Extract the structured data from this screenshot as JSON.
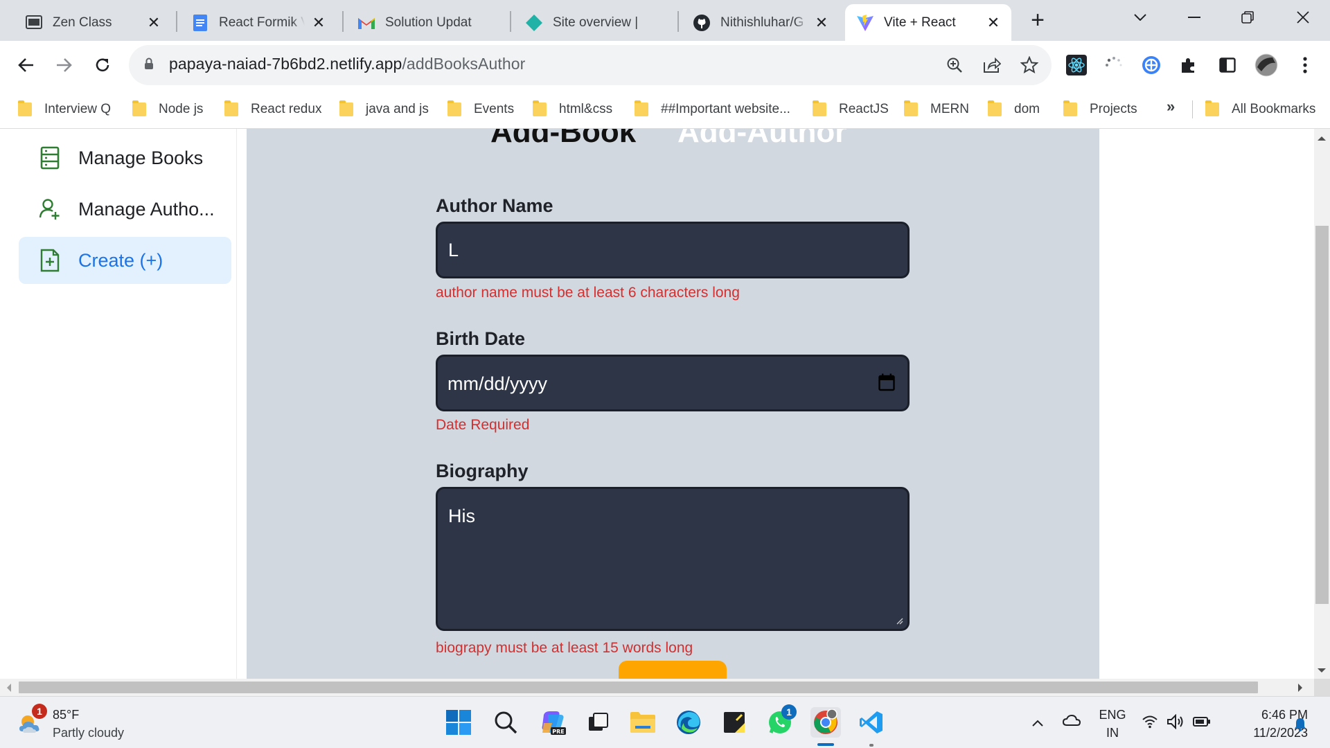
{
  "browser": {
    "tabs": [
      {
        "title": "Zen Class",
        "favicon": "zen-class-favicon"
      },
      {
        "title": "React Formik V",
        "favicon": "google-docs-favicon"
      },
      {
        "title": "Solution Updat",
        "favicon": "gmail-favicon"
      },
      {
        "title": "Site overview |",
        "favicon": "netlify-favicon"
      },
      {
        "title": "Nithishluhar/G",
        "favicon": "github-favicon"
      },
      {
        "title": "Vite + React",
        "favicon": "vite-favicon",
        "active": true
      }
    ],
    "address_bar": {
      "host": "papaya-naiad-7b6bd2.netlify.app",
      "path": "/addBooksAuthor"
    },
    "bookmarks": [
      "Interview Q",
      "Node js",
      "React redux",
      "java and js",
      "Events",
      "html&css",
      "##Important website...",
      "ReactJS",
      "MERN",
      "dom",
      "Projects"
    ],
    "bookmarks_overflow": "»",
    "all_bookmarks": "All Bookmarks"
  },
  "sidebar": {
    "items": [
      {
        "label": "Manage Books",
        "icon": "book-list-icon"
      },
      {
        "label": "Manage Autho...",
        "icon": "user-add-icon"
      },
      {
        "label": "Create (+)",
        "icon": "document-add-icon",
        "active": true
      }
    ]
  },
  "main": {
    "tabs": {
      "add_book": "Add-Book",
      "add_author": "Add-Author"
    },
    "form": {
      "author_name": {
        "label": "Author Name",
        "value": "L",
        "error": "author name must be at least 6 characters long"
      },
      "birth_date": {
        "label": "Birth Date",
        "placeholder": "mm/dd/yyyy",
        "error": "Date Required"
      },
      "biography": {
        "label": "Biography",
        "value": "His",
        "error": "biograpy must be at least 15 words long"
      }
    }
  },
  "taskbar": {
    "weather": {
      "temp": "85°F",
      "condition": "Partly cloudy",
      "badge": "1"
    },
    "whatsapp_badge": "1",
    "language": {
      "primary": "ENG",
      "secondary": "IN"
    },
    "clock": {
      "time": "6:46 PM",
      "date": "11/2/2023"
    }
  },
  "colors": {
    "form_background": "#d1d8e0",
    "input_background": "#2d3546",
    "error_text": "#d32f2f",
    "active_sidebar": "#e3f0fd",
    "accent_blue": "#1a73e8",
    "submit_button": "#ffa500"
  }
}
